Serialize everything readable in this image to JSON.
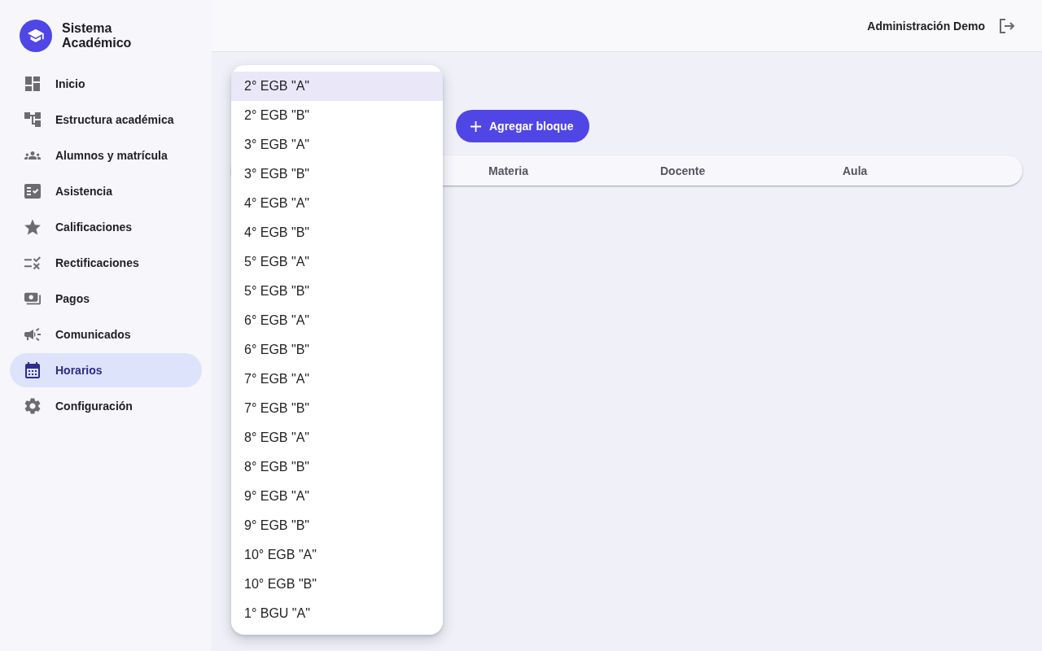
{
  "sidebar": {
    "brand": {
      "title": "Sistema Académico"
    },
    "items": [
      {
        "label": "Inicio",
        "selected": false
      },
      {
        "label": "Estructura académica",
        "selected": false
      },
      {
        "label": "Alumnos y matrícula",
        "selected": false
      },
      {
        "label": "Asistencia",
        "selected": false
      },
      {
        "label": "Calificaciones",
        "selected": false
      },
      {
        "label": "Rectificaciones",
        "selected": false
      },
      {
        "label": "Pagos",
        "selected": false
      },
      {
        "label": "Comunicados",
        "selected": false
      },
      {
        "label": "Horarios",
        "selected": true
      },
      {
        "label": "Configuración",
        "selected": false
      }
    ]
  },
  "header": {
    "user": "Administración Demo"
  },
  "toolbar": {
    "add_button": "Agregar bloque"
  },
  "table": {
    "columns": [
      "Materia",
      "Docente",
      "Aula"
    ]
  },
  "dropdown": {
    "options": [
      {
        "label": "2° EGB \"A\"",
        "selected": true
      },
      {
        "label": "2° EGB \"B\"",
        "selected": false
      },
      {
        "label": "3° EGB \"A\"",
        "selected": false
      },
      {
        "label": "3° EGB \"B\"",
        "selected": false
      },
      {
        "label": "4° EGB \"A\"",
        "selected": false
      },
      {
        "label": "4° EGB \"B\"",
        "selected": false
      },
      {
        "label": "5° EGB \"A\"",
        "selected": false
      },
      {
        "label": "5° EGB \"B\"",
        "selected": false
      },
      {
        "label": "6° EGB \"A\"",
        "selected": false
      },
      {
        "label": "6° EGB \"B\"",
        "selected": false
      },
      {
        "label": "7° EGB \"A\"",
        "selected": false
      },
      {
        "label": "7° EGB \"B\"",
        "selected": false
      },
      {
        "label": "8° EGB \"A\"",
        "selected": false
      },
      {
        "label": "8° EGB \"B\"",
        "selected": false
      },
      {
        "label": "9° EGB \"A\"",
        "selected": false
      },
      {
        "label": "9° EGB \"B\"",
        "selected": false
      },
      {
        "label": "10° EGB \"A\"",
        "selected": false
      },
      {
        "label": "10° EGB \"B\"",
        "selected": false
      },
      {
        "label": "1° BGU \"A\"",
        "selected": false
      }
    ]
  }
}
